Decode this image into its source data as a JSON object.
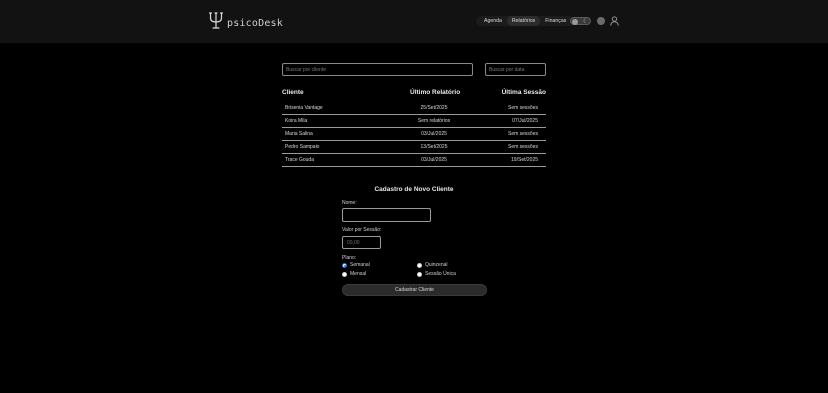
{
  "app": {
    "name": "psicoDesk",
    "logo_icon": "psi-trident-icon"
  },
  "nav": {
    "items": [
      {
        "label": "Agenda",
        "active": false
      },
      {
        "label": "Relatórios",
        "active": true
      },
      {
        "label": "Finanças",
        "active": false
      }
    ],
    "theme_toggle": "theme-toggle-icon",
    "settings_icon": "gear-icon",
    "profile_icon": "user-icon"
  },
  "search": {
    "client_placeholder": "Buscar por cliente",
    "date_placeholder": "Buscar por data"
  },
  "table": {
    "headers": [
      "Cliente",
      "Último Relatório",
      "Última Sessão"
    ],
    "rows": [
      [
        "Brisenia Vantage",
        "25/Set/2025",
        "Sem sessões"
      ],
      [
        "Koira Mila",
        "Sem relatórios",
        "07/Jul/2025"
      ],
      [
        "Maria Salina",
        "03/Jul/2025",
        "Sem sessões"
      ],
      [
        "Pedro Sampaio",
        "13/Set/2025",
        "Sem sessões"
      ],
      [
        "Trace Gouda",
        "03/Jul/2025",
        "19/Set/2025"
      ]
    ]
  },
  "form": {
    "title": "Cadastro de Novo Cliente",
    "name_label": "Nome:",
    "name_value": "",
    "price_label": "Valor por Sessão:",
    "price_placeholder": "00,00",
    "plan_label": "Plano:",
    "plans": [
      {
        "label": "Semanal",
        "checked": true
      },
      {
        "label": "Quinzenal",
        "checked": false
      },
      {
        "label": "Mensal",
        "checked": false
      },
      {
        "label": "Sessão Única",
        "checked": false
      }
    ],
    "submit_label": "Cadastrar Cliente"
  },
  "colors": {
    "background": "#000000",
    "header": "#121212",
    "radio_accent": "#2f6fd6"
  }
}
